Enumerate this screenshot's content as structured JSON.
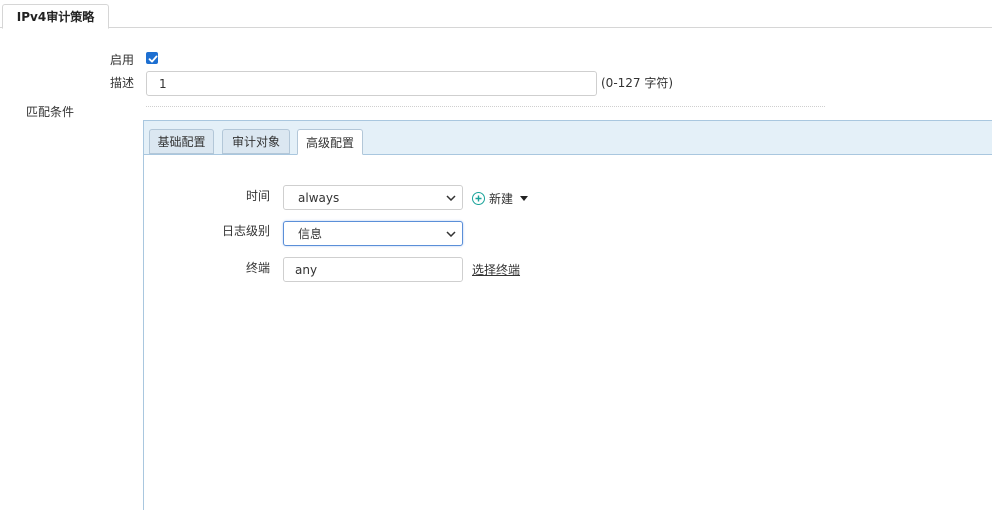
{
  "top_tab": {
    "label": "IPv4审计策略"
  },
  "form": {
    "enable_label": "启用",
    "enable_checked": true,
    "desc_label": "描述",
    "desc_value": "1",
    "desc_hint": "(0-127 字符)",
    "match_label": "匹配条件"
  },
  "tabs": [
    {
      "label": "基础配置",
      "active": false
    },
    {
      "label": "审计对象",
      "active": false
    },
    {
      "label": "高级配置",
      "active": true
    }
  ],
  "advanced": {
    "time_label": "时间",
    "time_value": "always",
    "new_label": "新建",
    "log_level_label": "日志级别",
    "log_level_value": "信息",
    "terminal_label": "终端",
    "terminal_value": "any",
    "select_terminal_link": "选择终端"
  },
  "colors": {
    "accent_blue": "#1d6fd1",
    "panel_header": "#e4f0f8",
    "plus_icon": "#1aa39a"
  }
}
